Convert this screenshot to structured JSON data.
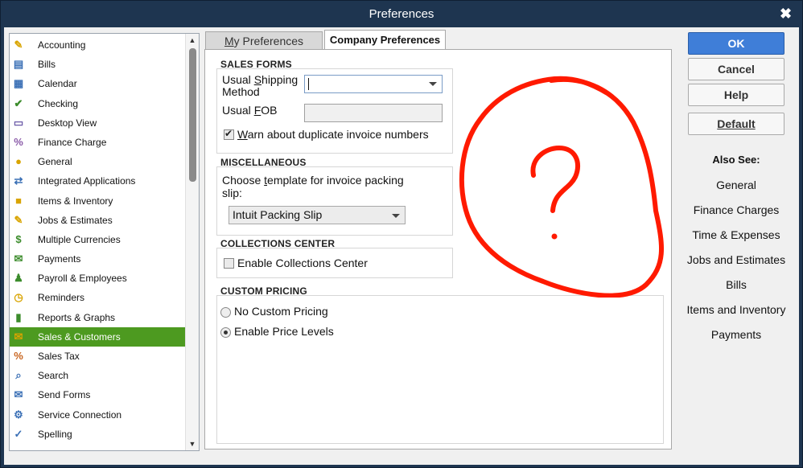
{
  "window": {
    "title": "Preferences"
  },
  "sidebar": {
    "items": [
      {
        "label": "Accounting",
        "icon": "accounting-icon"
      },
      {
        "label": "Bills",
        "icon": "bills-icon"
      },
      {
        "label": "Calendar",
        "icon": "calendar-icon"
      },
      {
        "label": "Checking",
        "icon": "checking-icon"
      },
      {
        "label": "Desktop View",
        "icon": "desktop-view-icon"
      },
      {
        "label": "Finance Charge",
        "icon": "finance-charge-icon"
      },
      {
        "label": "General",
        "icon": "general-icon"
      },
      {
        "label": "Integrated Applications",
        "icon": "integrated-apps-icon"
      },
      {
        "label": "Items & Inventory",
        "icon": "items-inventory-icon"
      },
      {
        "label": "Jobs & Estimates",
        "icon": "jobs-estimates-icon"
      },
      {
        "label": "Multiple Currencies",
        "icon": "currencies-icon"
      },
      {
        "label": "Payments",
        "icon": "payments-icon"
      },
      {
        "label": "Payroll & Employees",
        "icon": "payroll-icon"
      },
      {
        "label": "Reminders",
        "icon": "reminders-icon"
      },
      {
        "label": "Reports & Graphs",
        "icon": "reports-graphs-icon"
      },
      {
        "label": "Sales & Customers",
        "icon": "sales-customers-icon",
        "selected": true
      },
      {
        "label": "Sales Tax",
        "icon": "sales-tax-icon"
      },
      {
        "label": "Search",
        "icon": "search-icon"
      },
      {
        "label": "Send Forms",
        "icon": "send-forms-icon"
      },
      {
        "label": "Service Connection",
        "icon": "service-connection-icon"
      },
      {
        "label": "Spelling",
        "icon": "spelling-icon"
      }
    ]
  },
  "tabs": {
    "my_preferences_first": "M",
    "my_preferences_rest": "y Preferences",
    "company_preferences": "Company Preferences"
  },
  "sales_forms": {
    "title": "SALES FORMS",
    "shipping_label_1a": "Usual ",
    "shipping_label_1u": "S",
    "shipping_label_1b": "hipping",
    "shipping_label_2": "Method",
    "shipping_value": "",
    "fob_label_a": "Usual ",
    "fob_label_u": "F",
    "fob_label_b": "OB",
    "fob_value": "",
    "warn_u": "W",
    "warn_rest": "arn about duplicate invoice numbers",
    "warn_checked": true
  },
  "miscellaneous": {
    "title": "MISCELLANEOUS",
    "template_label_a": "Choose ",
    "template_label_u": "t",
    "template_label_b": "emplate for invoice packing",
    "template_label_2": "slip:",
    "template_value": "Intuit Packing Slip"
  },
  "collections": {
    "title": "COLLECTIONS CENTER",
    "enable_label": "Enable Collections Center",
    "enabled": false
  },
  "custom_pricing": {
    "title": "CUSTOM PRICING",
    "options": [
      "No Custom Pricing",
      "Enable Price Levels"
    ],
    "selected": 1
  },
  "buttons": {
    "ok": "OK",
    "cancel": "Cancel",
    "help": "Help",
    "default": "Default"
  },
  "also_see": {
    "title": "Also See:",
    "links": [
      "General",
      "Finance Charges",
      "Time & Expenses",
      "Jobs and Estimates",
      "Bills",
      "Items and Inventory",
      "Payments"
    ]
  },
  "colors": {
    "selected_green": "#4d9a20",
    "ok_blue": "#3f7ed8",
    "title_bar": "#1e3550",
    "doodle_red": "#ff1a00"
  }
}
